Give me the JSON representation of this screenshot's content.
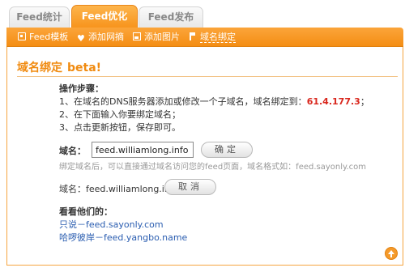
{
  "tabs": [
    "Feed统计",
    "Feed优化",
    "Feed发布"
  ],
  "active_tab": "Feed优化",
  "subnav": [
    {
      "label": "Feed模板",
      "icon": "feed-icon"
    },
    {
      "label": "添加网摘",
      "icon": "heart-icon"
    },
    {
      "label": "添加图片",
      "icon": "image-icon"
    },
    {
      "label": "域名绑定",
      "icon": "flag-icon"
    }
  ],
  "section": {
    "title": "域名绑定",
    "badge": "beta!"
  },
  "steps": {
    "heading": "操作步骤：",
    "step1_prefix": "1、在域名的DNS服务器添加或修改一个子域名，域名绑定到：",
    "step1_ip": "61.4.177.3",
    "step1_suffix": "；",
    "step2": "2、在下面输入你要绑定域名；",
    "step3": "3、点击更新按钮，保存即可。"
  },
  "domain_form": {
    "label": "域名：",
    "value": "feed.williamlong.info",
    "submit_label": "确定",
    "hint": "绑定域名后，可以直接通过域名访问您的feed页面，域名格式如：feed.sayonly.com"
  },
  "bound": {
    "text": "域名：feed.williamlong.info",
    "cancel_label": "取消"
  },
  "others": {
    "heading": "看看他们的：",
    "links": [
      "只说－feed.sayonly.com",
      "哈啰彼岸－feed.yangbo.name"
    ]
  },
  "colors": {
    "accent": "#f7941d",
    "link": "#2a5db0",
    "highlight": "#d9261c"
  }
}
